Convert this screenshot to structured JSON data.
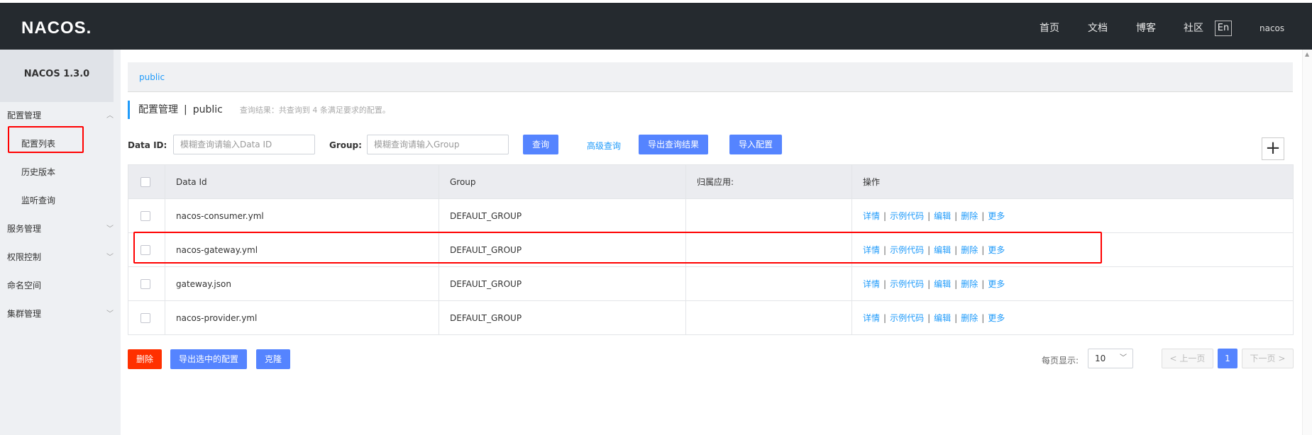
{
  "header": {
    "logo": "NACOS.",
    "nav": [
      "首页",
      "文档",
      "博客",
      "社区"
    ],
    "lang": "En",
    "user": "nacos"
  },
  "sidebar": {
    "version": "NACOS 1.3.0",
    "groups": [
      {
        "label": "配置管理",
        "expanded": true
      },
      {
        "label": "服务管理"
      },
      {
        "label": "权限控制"
      },
      {
        "label": "命名空间"
      },
      {
        "label": "集群管理"
      }
    ],
    "config_items": [
      "配置列表",
      "历史版本",
      "监听查询"
    ]
  },
  "breadcrumb": "public",
  "title": {
    "main": "配置管理",
    "separator": "|",
    "namespace": "public",
    "hint": "查询结果：共查询到 4 条满足要求的配置。"
  },
  "search": {
    "dataid_label": "Data ID:",
    "dataid_placeholder": "模糊查询请输入Data ID",
    "group_label": "Group:",
    "group_placeholder": "模糊查询请输入Group",
    "query_btn": "查询",
    "advanced_link": "高级查询",
    "export_btn": "导出查询结果",
    "import_btn": "导入配置"
  },
  "table": {
    "headers": [
      "Data Id",
      "Group",
      "归属应用:",
      "操作"
    ],
    "rows": [
      {
        "data_id": "nacos-consumer.yml",
        "group": "DEFAULT_GROUP",
        "app": ""
      },
      {
        "data_id": "nacos-gateway.yml",
        "group": "DEFAULT_GROUP",
        "app": ""
      },
      {
        "data_id": "gateway.json",
        "group": "DEFAULT_GROUP",
        "app": ""
      },
      {
        "data_id": "nacos-provider.yml",
        "group": "DEFAULT_GROUP",
        "app": ""
      }
    ],
    "ops": [
      "详情",
      "示例代码",
      "编辑",
      "删除",
      "更多"
    ],
    "op_separator": "|"
  },
  "footer": {
    "delete_btn": "删除",
    "export_selected_btn": "导出选中的配置",
    "clone_btn": "克隆",
    "page_size_label": "每页显示:",
    "page_size": "10",
    "prev": "上一页",
    "current_page": "1",
    "next": "下一页"
  },
  "colors": {
    "topbar": "#252a2f",
    "primary": "#5584ff",
    "link": "#209bfa",
    "danger": "#ff3000",
    "highlight": "#ff0000"
  }
}
